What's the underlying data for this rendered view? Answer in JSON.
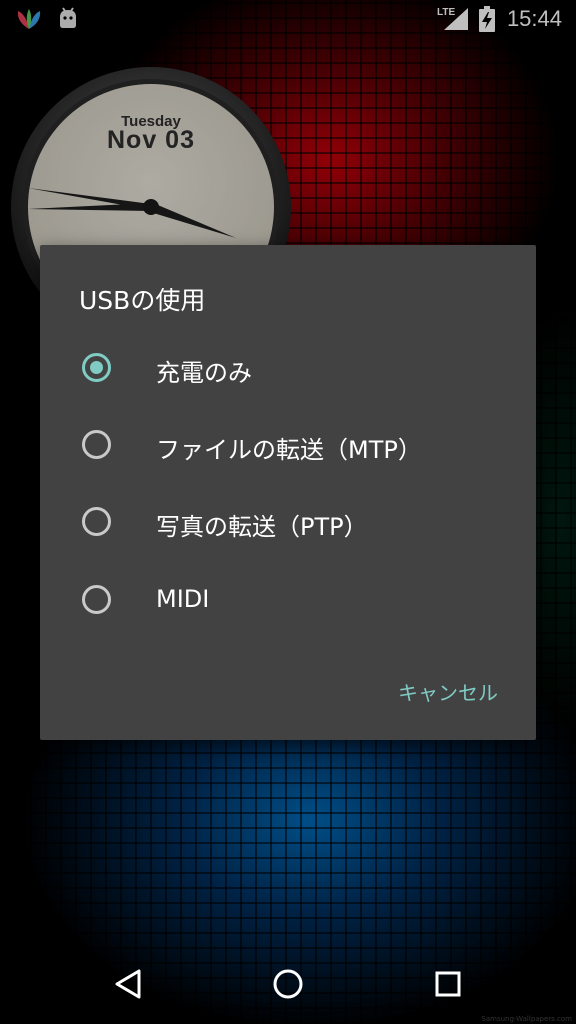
{
  "status_bar": {
    "network_type": "LTE",
    "time": "15:44",
    "left_icons": [
      "app-notification-icon",
      "android-debug-icon"
    ],
    "right_icons": [
      "signal-icon",
      "battery-charging-icon"
    ]
  },
  "clock_widget": {
    "day": "Tuesday",
    "date": "Nov 03"
  },
  "dialog": {
    "title": "USBの使用",
    "options": [
      {
        "label": "充電のみ",
        "selected": true
      },
      {
        "label": "ファイルの転送（MTP）",
        "selected": false
      },
      {
        "label": "写真の転送（PTP）",
        "selected": false
      },
      {
        "label": "MIDI",
        "selected": false
      }
    ],
    "cancel_label": "キャンセル",
    "accent_color": "#80cbc4",
    "background_color": "#424242"
  },
  "nav_bar": {
    "buttons": [
      "back-icon",
      "home-icon",
      "recents-icon"
    ]
  },
  "watermark": "Samsung-Wallpapers.com"
}
